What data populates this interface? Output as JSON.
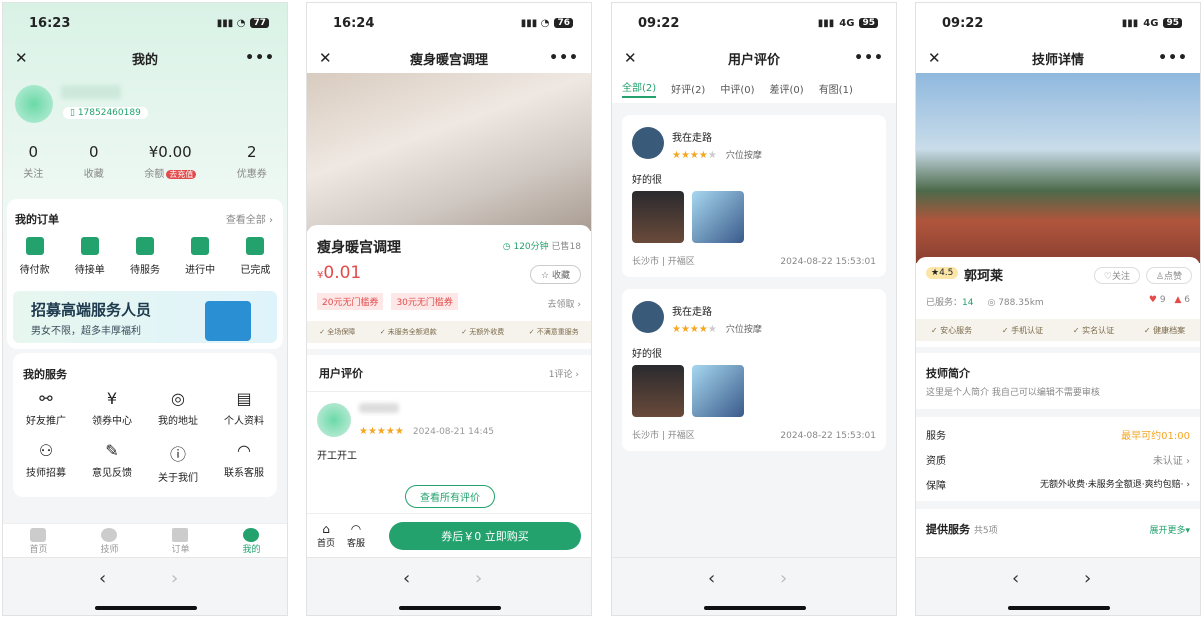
{
  "p1": {
    "time": "16:23",
    "battery": "77",
    "title": "我的",
    "phone": "17852460189",
    "stats": [
      {
        "value": "0",
        "label": "关注"
      },
      {
        "value": "0",
        "label": "收藏"
      },
      {
        "value": "¥0.00",
        "label": "余额"
      },
      {
        "value": "2",
        "label": "优惠券"
      }
    ],
    "recharge": "去充值",
    "orders_title": "我的订单",
    "orders_all": "查看全部",
    "orders": [
      {
        "label": "待付款"
      },
      {
        "label": "待接单"
      },
      {
        "label": "待服务"
      },
      {
        "label": "进行中"
      },
      {
        "label": "已完成"
      }
    ],
    "banner_title": "招募高端服务人员",
    "banner_sub": "男女不限，超多丰厚福利",
    "services_title": "我的服务",
    "services": [
      {
        "label": "好友推广"
      },
      {
        "label": "领券中心"
      },
      {
        "label": "我的地址"
      },
      {
        "label": "个人资料"
      },
      {
        "label": "技师招募"
      },
      {
        "label": "意见反馈"
      },
      {
        "label": "关于我们"
      },
      {
        "label": "联系客服"
      }
    ],
    "tabs": [
      {
        "label": "首页"
      },
      {
        "label": "技师"
      },
      {
        "label": "订单"
      },
      {
        "label": "我的"
      }
    ]
  },
  "p2": {
    "time": "16:24",
    "battery": "76",
    "title": "瘦身暖宫调理",
    "name": "瘦身暖宫调理",
    "duration": "120分钟",
    "sold": "已售18",
    "price": "0.01",
    "price_sym": "¥",
    "fav": "收藏",
    "coupons": [
      "20元无门槛券",
      "30元无门槛券"
    ],
    "get": "去领取",
    "guarantees": [
      "全场保障",
      "未服务全额退款",
      "无额外收费",
      "不满意重服务"
    ],
    "review_title": "用户评价",
    "review_count": "1评论",
    "review_date": "2024-08-21 14:45",
    "review_text": "开工开工",
    "view_all": "查看所有评价",
    "home": "首页",
    "service": "客服",
    "buy": "券后￥0 立即购买"
  },
  "p3": {
    "time": "09:22",
    "net": "4G",
    "battery": "95",
    "title": "用户评价",
    "tabs": [
      {
        "label": "全部(2)"
      },
      {
        "label": "好评(2)"
      },
      {
        "label": "中评(0)"
      },
      {
        "label": "差评(0)"
      },
      {
        "label": "有图(1)"
      }
    ],
    "reviews": [
      {
        "user": "我在走路",
        "project": "穴位按摩",
        "text": "好的很",
        "city": "长沙市",
        "district": "开福区",
        "date": "2024-08-22 15:53:01"
      },
      {
        "user": "我在走路",
        "project": "穴位按摩",
        "text": "好的很",
        "city": "长沙市",
        "district": "开福区",
        "date": "2024-08-22 15:53:01"
      }
    ]
  },
  "p4": {
    "time": "09:22",
    "net": "4G",
    "battery": "95",
    "title": "技师详情",
    "rating": "4.5",
    "name": "郭珂莱",
    "follow": "关注",
    "like": "点赞",
    "served_label": "已服务：",
    "served": "14",
    "distance": "788.35km",
    "hearts": "9",
    "thumbs": "6",
    "badges": [
      "安心服务",
      "手机认证",
      "实名认证",
      "健康档案"
    ],
    "intro_title": "技师简介",
    "intro": "这里是个人简介 我自己可以编辑不需要审核",
    "rows": [
      {
        "k": "服务",
        "v": "最早可约01:00"
      },
      {
        "k": "资质",
        "v": "未认证"
      },
      {
        "k": "保障",
        "v": "无额外收费·未服务全额退·爽约包赔·"
      }
    ],
    "provide": "提供服务",
    "provide_count": "共5项",
    "expand": "展开更多"
  },
  "colors": {
    "brand": "#23a26d",
    "price": "#e34b4b",
    "gold": "#f5a623"
  }
}
